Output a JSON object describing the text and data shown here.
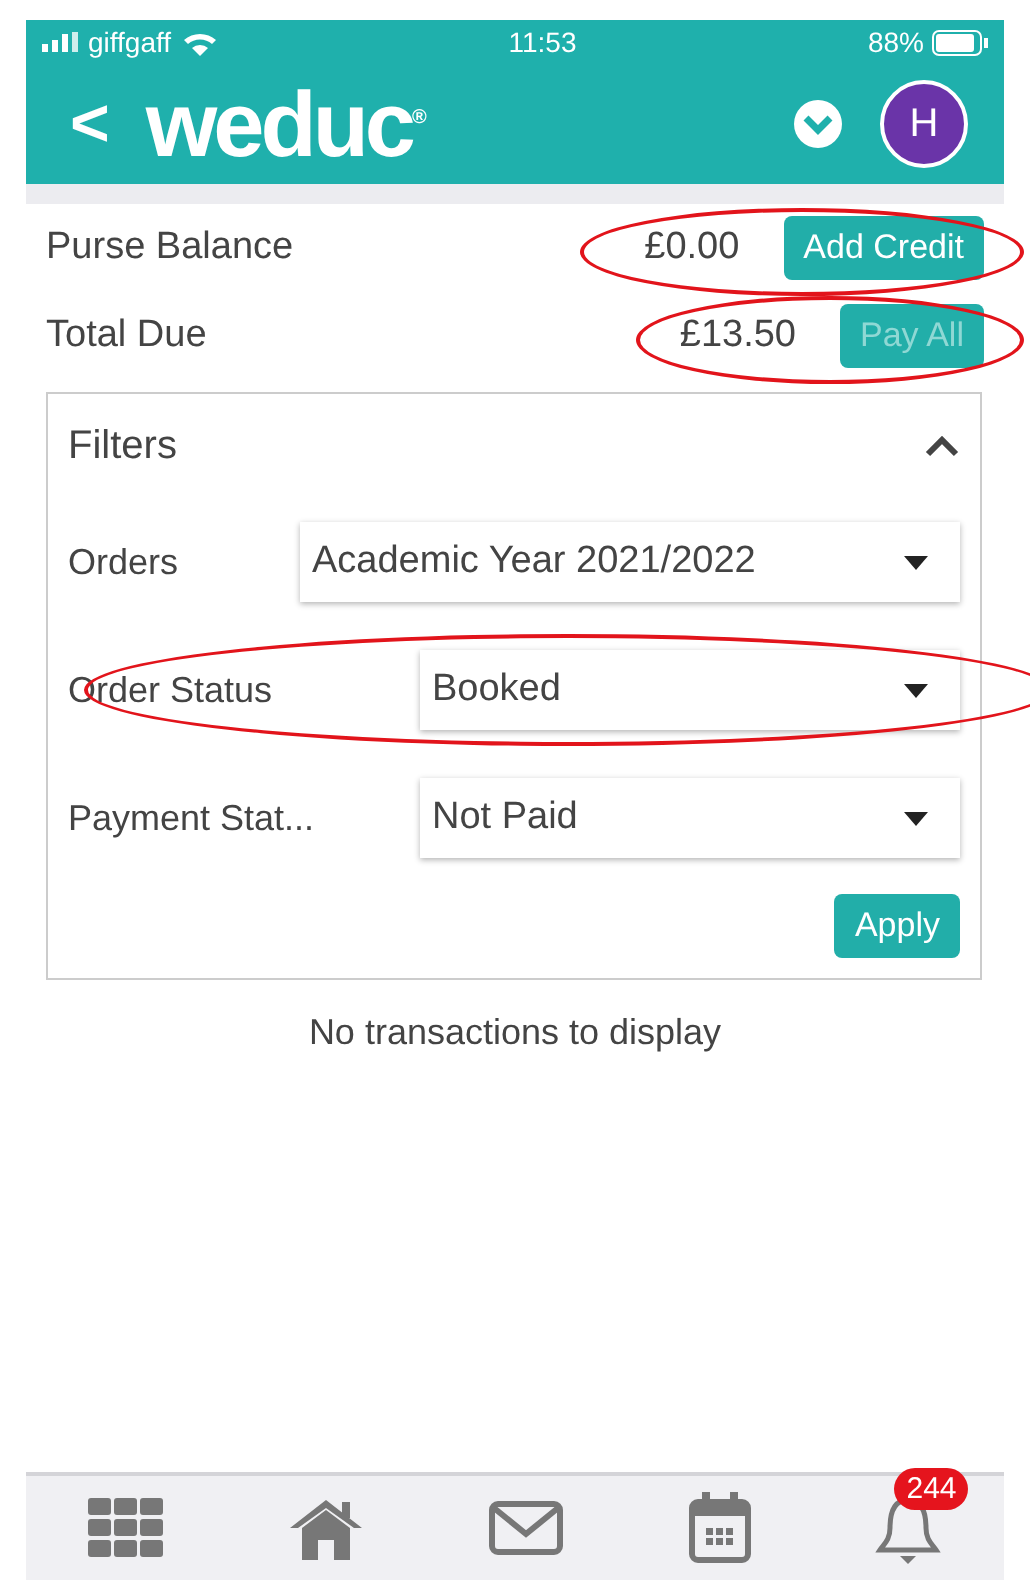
{
  "status_bar": {
    "carrier": "giffgaff",
    "time": "11:53",
    "battery": "88%"
  },
  "header": {
    "back": "<",
    "logo": "weduc$^{®}$",
    "avatar": "H"
  },
  "summary": [
    {
      "label": "Purse Balance",
      "amount": "£0.00",
      "button": "Add Credit",
      "disabled": false
    },
    {
      "label": "Total Due",
      "amount": "£13.50",
      "button": "Pay All",
      "disabled": true
    }
  ],
  "filters": {
    "title": "Filters",
    "expanded": true,
    "fields": [
      {
        "label": "Orders",
        "value": "Academic Year 2021/2022"
      },
      {
        "label": "Order Status",
        "value": "Booked"
      },
      {
        "label": "Payment Stat...",
        "value": "Not Paid"
      }
    ],
    "apply": "Apply"
  },
  "empty_message": "No transactions to display",
  "nav": [
    {
      "kind": "grid"
    },
    {
      "kind": "home"
    },
    {
      "kind": "mail"
    },
    {
      "kind": "calendar"
    },
    {
      "kind": "bell",
      "badge": "244"
    }
  ]
}
